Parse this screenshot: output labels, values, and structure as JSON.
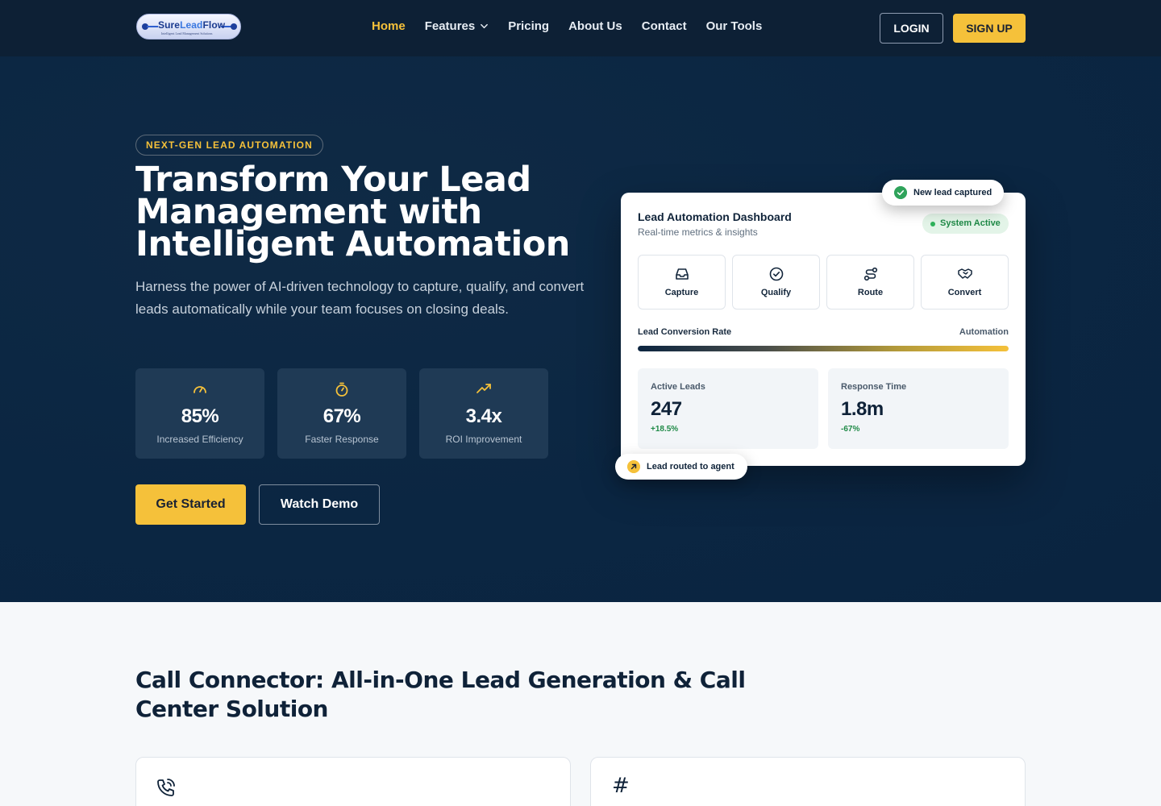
{
  "brand": {
    "logo_text_main": "Sure",
    "logo_text_accent": "Lead",
    "logo_text_end": "Flow",
    "logo_tagline": "Intelligent Lead Management Solutions"
  },
  "nav": {
    "links": [
      "Home",
      "Features",
      "Pricing",
      "About Us",
      "Contact",
      "Our Tools"
    ],
    "active": "Home",
    "login_label": "LOGIN",
    "signup_label": "SIGN UP"
  },
  "hero": {
    "badge": "NEXT-GEN LEAD AUTOMATION",
    "title": "Transform Your Lead Management with Intelligent Automation",
    "subtitle": "Harness the power of AI-driven technology to capture, qualify, and convert leads automatically while your team focuses on closing deals.",
    "stats": [
      {
        "icon": "gauge-icon",
        "value": "85%",
        "label": "Increased Efficiency"
      },
      {
        "icon": "stopwatch-icon",
        "value": "67%",
        "label": "Faster Response"
      },
      {
        "icon": "trending-up-icon",
        "value": "3.4x",
        "label": "ROI Improvement"
      }
    ],
    "cta_primary": "Get Started",
    "cta_secondary": "Watch Demo"
  },
  "dashboard": {
    "title": "Lead Automation Dashboard",
    "subtitle": "Real-time metrics & insights",
    "status": "System Active",
    "steps": [
      {
        "icon": "inbox-icon",
        "label": "Capture"
      },
      {
        "icon": "badge-check-icon",
        "label": "Qualify"
      },
      {
        "icon": "route-icon",
        "label": "Route"
      },
      {
        "icon": "handshake-icon",
        "label": "Convert"
      }
    ],
    "conversion_label": "Lead Conversion Rate",
    "conversion_right_label": "Automation",
    "conversion_fraction": 1.0,
    "metrics": [
      {
        "label": "Active Leads",
        "value": "247",
        "change": "+18.5%"
      },
      {
        "label": "Response Time",
        "value": "1.8m",
        "change": "-67%"
      }
    ],
    "toast_new": "New lead captured",
    "toast_routed": "Lead routed to agent"
  },
  "section2": {
    "title": "Call Connector: All-in-One Lead Generation & Call Center Solution",
    "cards": [
      {
        "icon": "phone-call-icon"
      },
      {
        "icon": "hash-icon",
        "glyph": "#"
      }
    ]
  },
  "colors": {
    "accent": "#f5c13a",
    "hero_bg": "#0b2642",
    "nav_bg": "#0d2035",
    "success": "#1f8a47"
  }
}
